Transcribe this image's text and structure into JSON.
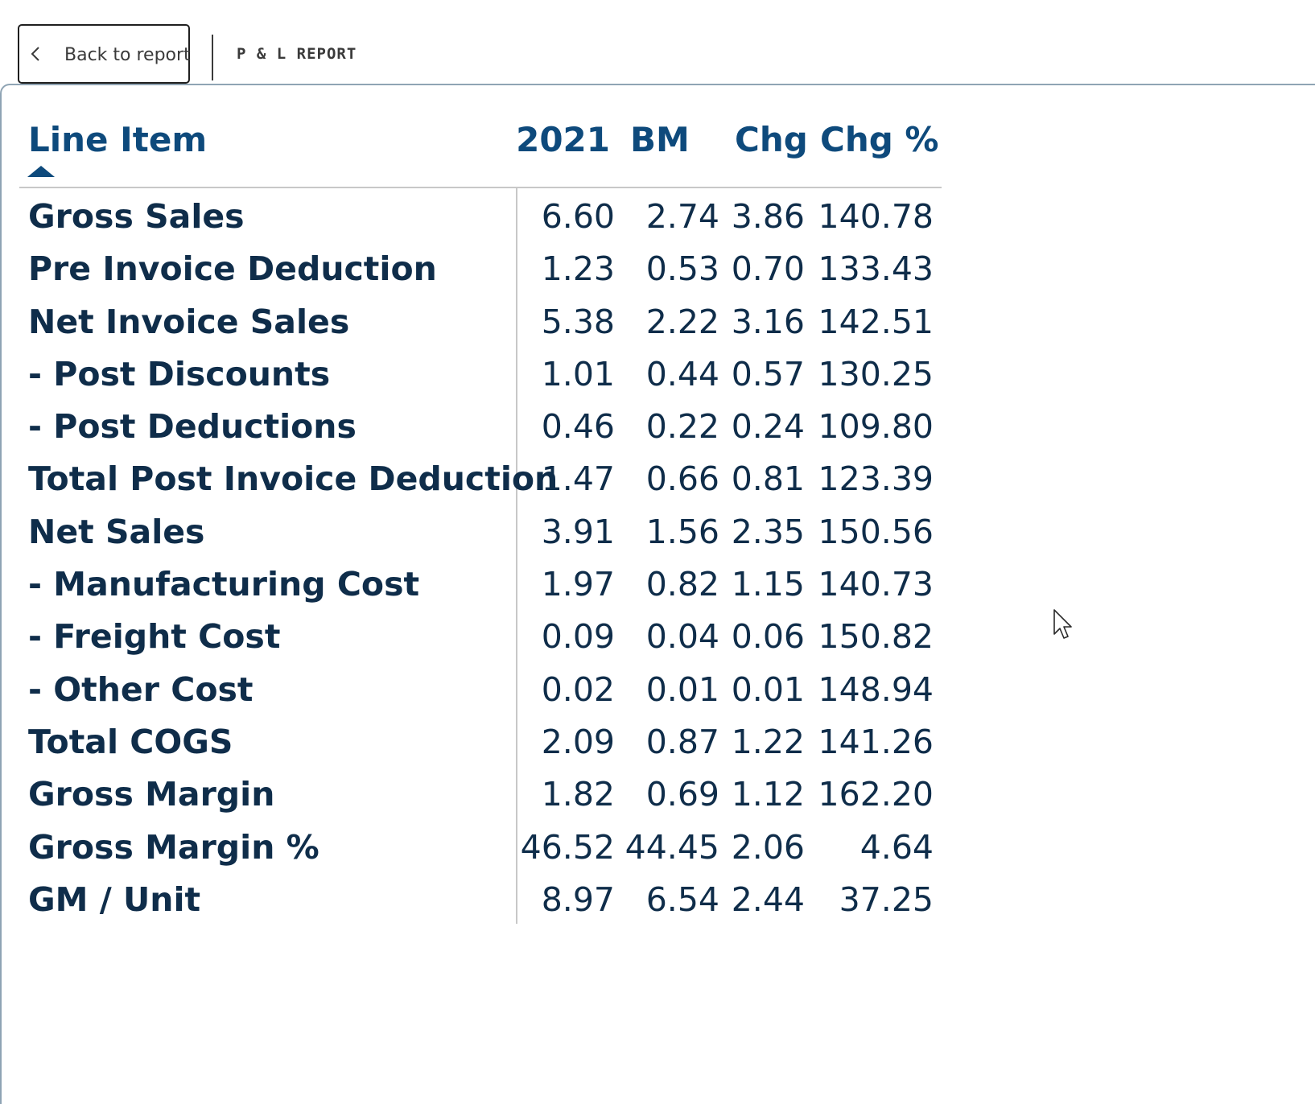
{
  "header": {
    "back_label": "Back to report",
    "report_title": "P & L REPORT"
  },
  "table": {
    "columns": [
      "Line Item",
      "2021",
      "BM",
      "Chg",
      "Chg %"
    ],
    "sort": {
      "column": "Line Item",
      "direction": "ascending"
    },
    "rows": [
      {
        "item": "Gross Sales",
        "y2021": "6.60",
        "bm": "2.74",
        "chg": "3.86",
        "chg_pct": "140.78"
      },
      {
        "item": "Pre Invoice Deduction",
        "y2021": "1.23",
        "bm": "0.53",
        "chg": "0.70",
        "chg_pct": "133.43"
      },
      {
        "item": "Net Invoice Sales",
        "y2021": "5.38",
        "bm": "2.22",
        "chg": "3.16",
        "chg_pct": "142.51"
      },
      {
        "item": "- Post Discounts",
        "y2021": "1.01",
        "bm": "0.44",
        "chg": "0.57",
        "chg_pct": "130.25"
      },
      {
        "item": "- Post Deductions",
        "y2021": "0.46",
        "bm": "0.22",
        "chg": "0.24",
        "chg_pct": "109.80"
      },
      {
        "item": "Total Post Invoice Deduction",
        "y2021": "1.47",
        "bm": "0.66",
        "chg": "0.81",
        "chg_pct": "123.39"
      },
      {
        "item": "Net Sales",
        "y2021": "3.91",
        "bm": "1.56",
        "chg": "2.35",
        "chg_pct": "150.56"
      },
      {
        "item": "- Manufacturing Cost",
        "y2021": "1.97",
        "bm": "0.82",
        "chg": "1.15",
        "chg_pct": "140.73"
      },
      {
        "item": "- Freight Cost",
        "y2021": "0.09",
        "bm": "0.04",
        "chg": "0.06",
        "chg_pct": "150.82"
      },
      {
        "item": "- Other Cost",
        "y2021": "0.02",
        "bm": "0.01",
        "chg": "0.01",
        "chg_pct": "148.94"
      },
      {
        "item": "Total COGS",
        "y2021": "2.09",
        "bm": "0.87",
        "chg": "1.22",
        "chg_pct": "141.26"
      },
      {
        "item": "Gross Margin",
        "y2021": "1.82",
        "bm": "0.69",
        "chg": "1.12",
        "chg_pct": "162.20"
      },
      {
        "item": "Gross Margin %",
        "y2021": "46.52",
        "bm": "44.45",
        "chg": "2.06",
        "chg_pct": "4.64"
      },
      {
        "item": "GM / Unit",
        "y2021": "8.97",
        "bm": "6.54",
        "chg": "2.44",
        "chg_pct": "37.25"
      }
    ]
  },
  "icons": {
    "back": "chevron-left-icon",
    "sort": "sort-ascending-icon",
    "cursor": "mouse-pointer-icon"
  },
  "colors": {
    "header_text": "#0e4a7c",
    "body_text": "#0f2d4a",
    "rule": "#c8c8c8",
    "frame": "#8fa4b4"
  }
}
